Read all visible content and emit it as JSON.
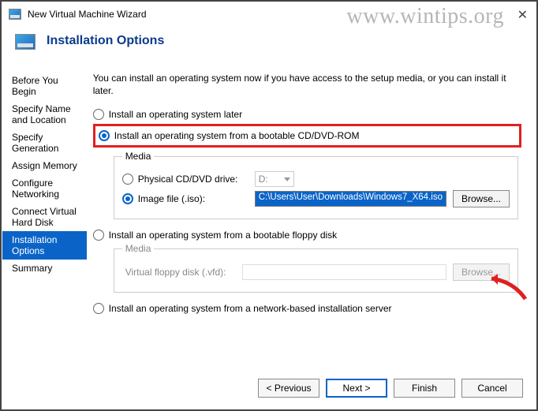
{
  "window": {
    "title": "New Virtual Machine Wizard"
  },
  "watermark": "www.wintips.org",
  "header": {
    "title": "Installation Options"
  },
  "sidebar": {
    "items": [
      {
        "label": "Before You Begin"
      },
      {
        "label": "Specify Name and Location"
      },
      {
        "label": "Specify Generation"
      },
      {
        "label": "Assign Memory"
      },
      {
        "label": "Configure Networking"
      },
      {
        "label": "Connect Virtual Hard Disk"
      },
      {
        "label": "Installation Options"
      },
      {
        "label": "Summary"
      }
    ],
    "active_index": 6
  },
  "main": {
    "description": "You can install an operating system now if you have access to the setup media, or you can install it later.",
    "options": {
      "later": "Install an operating system later",
      "cd": "Install an operating system from a bootable CD/DVD-ROM",
      "floppy": "Install an operating system from a bootable floppy disk",
      "network": "Install an operating system from a network-based installation server"
    },
    "media_cd": {
      "legend": "Media",
      "physical_label": "Physical CD/DVD drive:",
      "physical_drive": "D:",
      "image_label": "Image file (.iso):",
      "iso_path": "C:\\Users\\User\\Downloads\\Windows7_X64.iso",
      "browse": "Browse..."
    },
    "media_floppy": {
      "legend": "Media",
      "vfd_label": "Virtual floppy disk (.vfd):",
      "browse": "Browse..."
    }
  },
  "footer": {
    "previous": "< Previous",
    "next": "Next >",
    "finish": "Finish",
    "cancel": "Cancel"
  }
}
